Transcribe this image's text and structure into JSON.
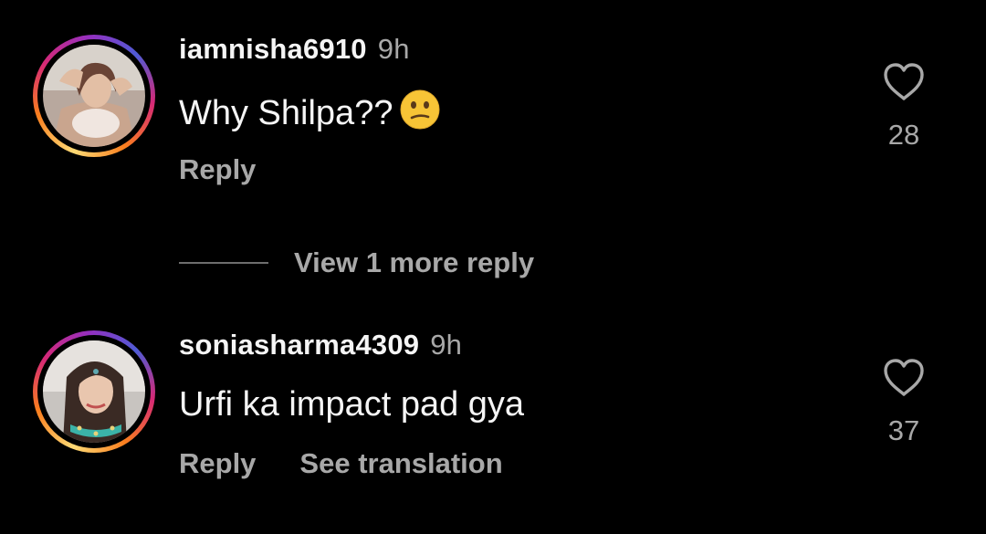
{
  "comments": [
    {
      "username": "iamnisha6910",
      "time": "9h",
      "text": "Why Shilpa??",
      "emoji": "confused-face",
      "likes": "28",
      "reply_label": "Reply"
    },
    {
      "username": "soniasharma4309",
      "time": "9h",
      "text": "Urfi ka impact pad gya",
      "likes": "37",
      "reply_label": "Reply",
      "translation_label": "See translation"
    }
  ],
  "view_more_replies": "View 1 more reply",
  "colors": {
    "background": "#000000",
    "primary_text": "#f5f5f5",
    "secondary_text": "#a8a8a8",
    "story_ring_start": "#feda75",
    "story_ring_end": "#962fbf"
  }
}
